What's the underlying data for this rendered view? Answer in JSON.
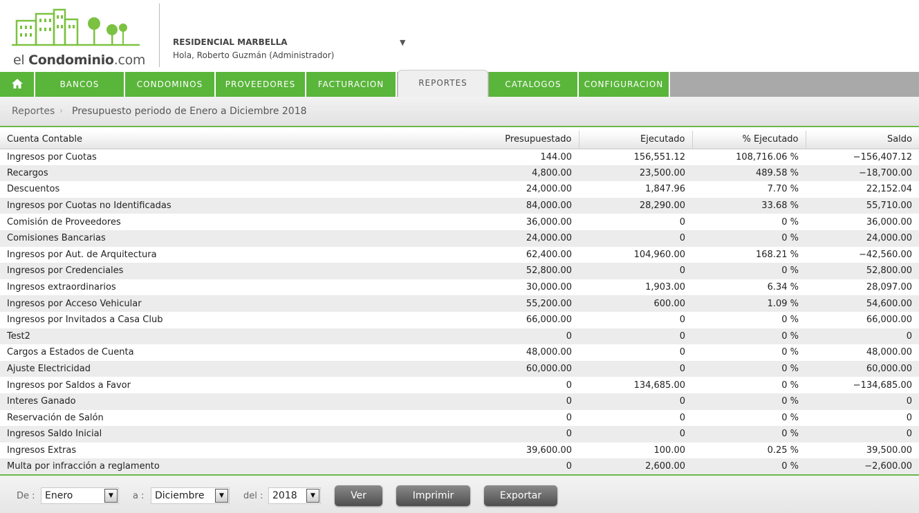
{
  "header": {
    "logo_text_prefix": "el ",
    "logo_text_bold": "Condominio",
    "logo_text_suffix": ".com",
    "org_name": "RESIDENCIAL MARBELLA",
    "greeting": "Hola, Roberto Guzmán (Administrador)",
    "dropdown_glyph": "▼"
  },
  "nav": {
    "home_icon": "home-icon",
    "items": [
      "BANCOS",
      "CONDOMINOS",
      "PROVEEDORES",
      "FACTURACION",
      "REPORTES",
      "CATALOGOS",
      "CONFIGURACION"
    ],
    "active": "REPORTES"
  },
  "breadcrumb": {
    "root": "Reportes",
    "separator": "›",
    "current": "Presupuesto periodo de Enero a Diciembre 2018"
  },
  "table": {
    "columns": [
      "Cuenta Contable",
      "Presupuestado",
      "Ejecutado",
      "% Ejecutado",
      "Saldo"
    ],
    "rows": [
      [
        "Ingresos por Cuotas",
        "144.00",
        "156,551.12",
        "108,716.06 %",
        "−156,407.12"
      ],
      [
        "Recargos",
        "4,800.00",
        "23,500.00",
        "489.58 %",
        "−18,700.00"
      ],
      [
        "Descuentos",
        "24,000.00",
        "1,847.96",
        "7.70 %",
        "22,152.04"
      ],
      [
        "Ingresos por Cuotas no Identificadas",
        "84,000.00",
        "28,290.00",
        "33.68 %",
        "55,710.00"
      ],
      [
        "Comisión de Proveedores",
        "36,000.00",
        "0",
        "0 %",
        "36,000.00"
      ],
      [
        "Comisiones Bancarias",
        "24,000.00",
        "0",
        "0 %",
        "24,000.00"
      ],
      [
        "Ingresos por Aut. de Arquitectura",
        "62,400.00",
        "104,960.00",
        "168.21 %",
        "−42,560.00"
      ],
      [
        "Ingresos por Credenciales",
        "52,800.00",
        "0",
        "0 %",
        "52,800.00"
      ],
      [
        "Ingresos extraordinarios",
        "30,000.00",
        "1,903.00",
        "6.34 %",
        "28,097.00"
      ],
      [
        "Ingresos por Acceso Vehicular",
        "55,200.00",
        "600.00",
        "1.09 %",
        "54,600.00"
      ],
      [
        "Ingresos por Invitados a Casa Club",
        "66,000.00",
        "0",
        "0 %",
        "66,000.00"
      ],
      [
        "Test2",
        "0",
        "0",
        "0 %",
        "0"
      ],
      [
        "Cargos a Estados de Cuenta",
        "48,000.00",
        "0",
        "0 %",
        "48,000.00"
      ],
      [
        "Ajuste Electricidad",
        "60,000.00",
        "0",
        "0 %",
        "60,000.00"
      ],
      [
        "Ingresos por Saldos a Favor",
        "0",
        "134,685.00",
        "0 %",
        "−134,685.00"
      ],
      [
        "Interes Ganado",
        "0",
        "0",
        "0 %",
        "0"
      ],
      [
        "Reservación de Salón",
        "0",
        "0",
        "0 %",
        "0"
      ],
      [
        "Ingresos Saldo Inicial",
        "0",
        "0",
        "0 %",
        "0"
      ],
      [
        "Ingresos Extras",
        "39,600.00",
        "100.00",
        "0.25 %",
        "39,500.00"
      ],
      [
        "Multa por infracción a reglamento",
        "0",
        "2,600.00",
        "0 %",
        "−2,600.00"
      ]
    ]
  },
  "filters": {
    "from_label": "De :",
    "from_value": "Enero",
    "to_label": "a :",
    "to_value": "Diciembre",
    "year_label": "del :",
    "year_value": "2018",
    "dropdown_glyph": "▼",
    "view_button": "Ver",
    "print_button": "Imprimir",
    "export_button": "Exportar"
  },
  "colors": {
    "brand_green": "#5ab53b",
    "nav_gray": "#a9a9a9",
    "button_dark": "#5a5a5a"
  }
}
